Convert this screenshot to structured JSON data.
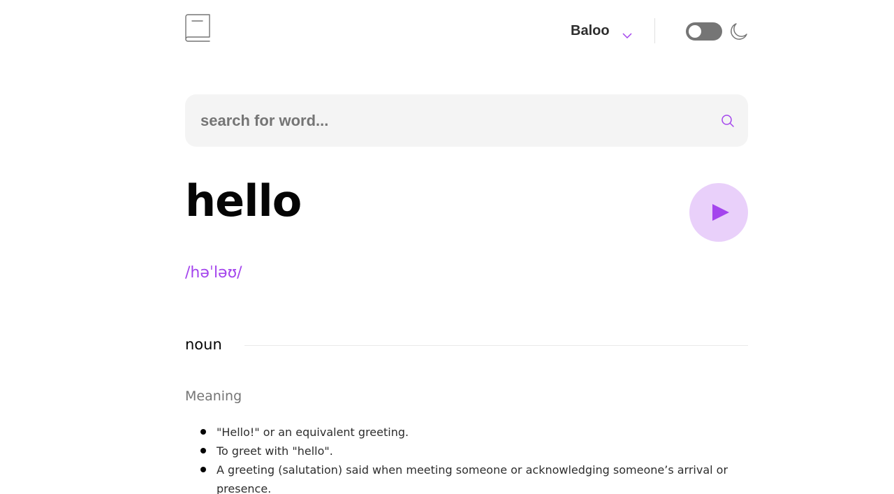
{
  "header": {
    "font_selector": {
      "selected": "Baloo"
    },
    "theme_toggle": {
      "state": "off"
    }
  },
  "search": {
    "placeholder": "search for word...",
    "value": ""
  },
  "entry": {
    "word": "hello",
    "phonetic": "/həˈləʊ/",
    "meanings": [
      {
        "part_of_speech": "noun",
        "label": "Meaning",
        "definitions": [
          "\"Hello!\" or an equivalent greeting.",
          "To greet with \"hello\".",
          "A greeting (salutation) said when meeting someone or acknowledging someone’s arrival or presence."
        ]
      }
    ]
  },
  "colors": {
    "accent": "#A445ED",
    "accent_light": "#E9D0FA",
    "text": "#050505",
    "muted": "#757575",
    "search_bg": "#F4F4F4"
  },
  "icons": {
    "logo": "book-icon",
    "dropdown": "chevron-down-icon",
    "theme": "moon-icon",
    "search": "search-icon",
    "play": "play-icon"
  }
}
